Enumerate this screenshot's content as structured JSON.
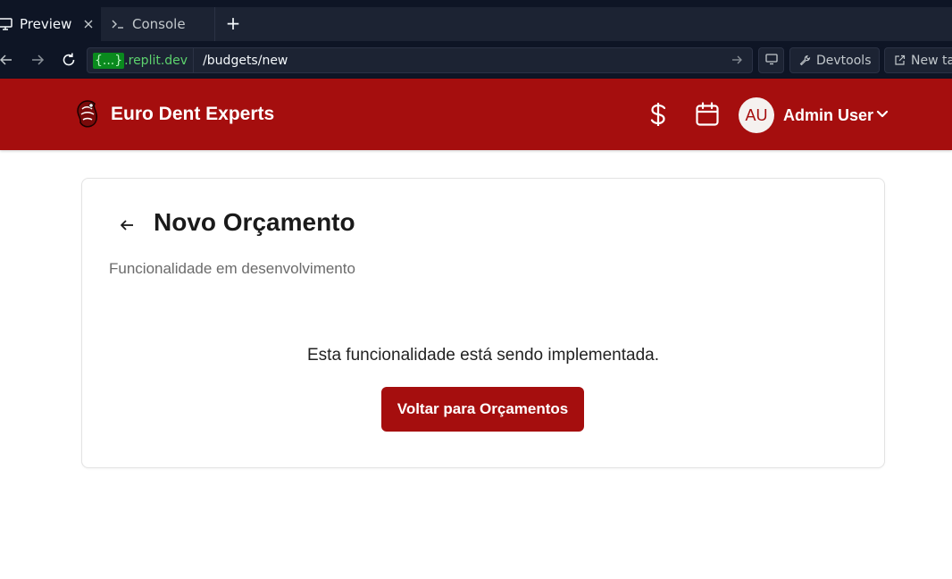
{
  "browser": {
    "tabs": [
      {
        "label": "Preview",
        "icon": "monitor-icon",
        "active": true
      },
      {
        "label": "Console",
        "icon": "terminal-icon",
        "active": false
      }
    ],
    "new_tab_symbol": "+",
    "url_host_badge": "{...}",
    "url_host": ".replit.dev",
    "url_path": "/budgets/new",
    "devtools_label": "Devtools",
    "new_tab_label": "New ta"
  },
  "app": {
    "brand_name": "Euro Dent Experts",
    "header_color": "#a50e0e",
    "header_icons": [
      "dollar-icon",
      "calendar-icon"
    ],
    "user": {
      "initials": "AU",
      "name": "Admin User"
    }
  },
  "page": {
    "title": "Novo Orçamento",
    "subtitle": "Funcionalidade em desenvolvimento",
    "message": "Esta funcionalidade está sendo implementada.",
    "button_label": "Voltar para Orçamentos"
  }
}
